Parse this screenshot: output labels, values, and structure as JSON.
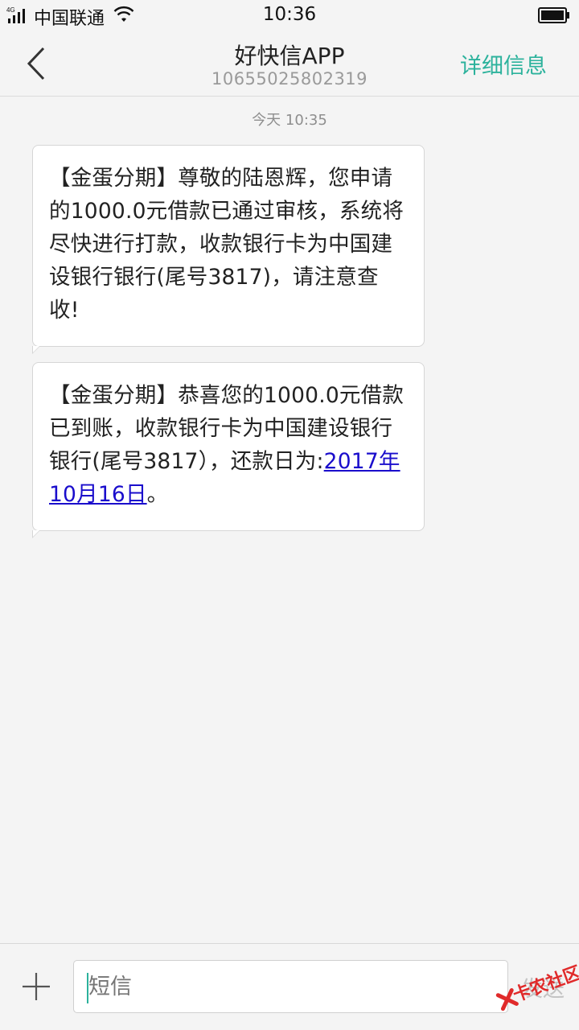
{
  "status_bar": {
    "network": "4G",
    "carrier": "中国联通",
    "time": "10:36"
  },
  "header": {
    "title": "好快信APP",
    "number": "10655025802319",
    "detail_label": "详细信息"
  },
  "conversation": {
    "date_label": "今天  10:35",
    "messages": [
      {
        "text": "【金蛋分期】尊敬的陆恩辉，您申请的1000.0元借款已通过审核，系统将尽快进行打款，收款银行卡为中国建设银行银行(尾号3817)，请注意查收!"
      },
      {
        "text_before": "【金蛋分期】恭喜您的1000.0元借款已到账，收款银行卡为中国建设银行银行(尾号3817），还款日为:",
        "link": "2017年10月16日",
        "text_after": "。"
      }
    ]
  },
  "input_bar": {
    "placeholder": "短信",
    "send_label": "发送"
  },
  "watermark": {
    "text": "卡农社区"
  },
  "colors": {
    "accent": "#2cb29c",
    "link": "#1a0dcc",
    "background": "#f4f4f4",
    "watermark": "#e02a2a"
  }
}
